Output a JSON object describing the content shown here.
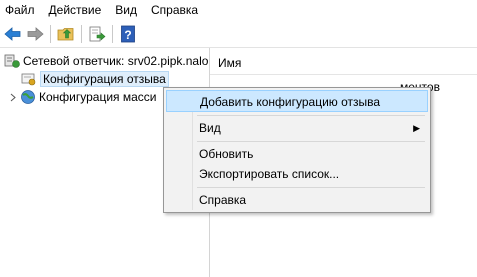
{
  "menubar": {
    "items": [
      "Файл",
      "Действие",
      "Вид",
      "Справка"
    ]
  },
  "toolbar": {
    "buttons": [
      "back-arrow-icon",
      "forward-arrow-icon",
      "up-folder-icon",
      "export-list-icon",
      "help-icon"
    ]
  },
  "tree": {
    "root": "Сетевой ответчик: srv02.pipk.nalo",
    "child1": "Конфигурация отзыва",
    "child2": "Конфигурация масси"
  },
  "list": {
    "column_name": "Имя",
    "cell_partial": "ментов"
  },
  "context_menu": {
    "items": [
      {
        "label": "Добавить конфигурацию отзыва",
        "highlighted": true
      },
      {
        "label": "Вид",
        "submenu": true
      },
      {
        "label": "Обновить"
      },
      {
        "label": "Экспортировать список..."
      },
      {
        "label": "Справка"
      }
    ]
  },
  "colors": {
    "highlight": "#cce8ff",
    "menu_bg": "#f2f2f2",
    "icon_blue": "#1e73be",
    "icon_green": "#3a9a3a"
  }
}
